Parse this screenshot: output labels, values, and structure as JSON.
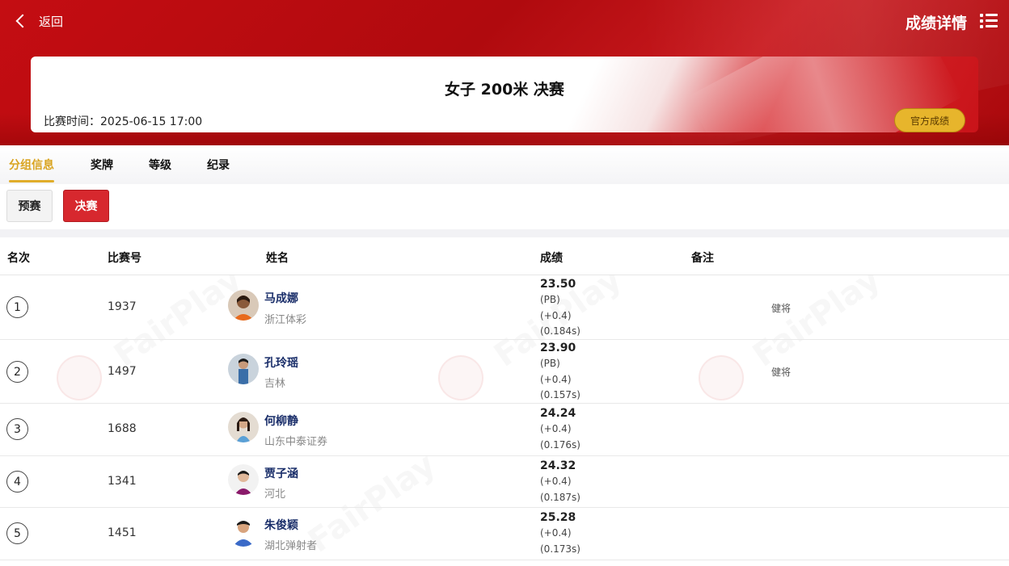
{
  "header": {
    "back_label": "返回",
    "title": "成绩详情",
    "back_icon": "chevron-left-icon",
    "menu_icon": "list-menu-icon"
  },
  "event": {
    "title": "女子 200米 决赛",
    "time": "比赛时间：2025-06-15  17:00",
    "official_button": "官方成绩"
  },
  "tabs": [
    {
      "label": "分组信息",
      "active": true
    },
    {
      "label": "奖牌",
      "active": false
    },
    {
      "label": "等级",
      "active": false
    },
    {
      "label": "纪录",
      "active": false
    }
  ],
  "rounds": [
    {
      "label": "预赛",
      "active": false
    },
    {
      "label": "决赛",
      "active": true
    }
  ],
  "table": {
    "columns": [
      "名次",
      "比赛号",
      "姓名",
      "成绩",
      "备注"
    ],
    "rows": [
      {
        "rank": "1",
        "bib": "1937",
        "name": "马成娜",
        "team": "浙江体彩",
        "result": "23.50",
        "details": [
          "(PB)",
          "(+0.4)",
          "(0.184s)"
        ],
        "note": "健将"
      },
      {
        "rank": "2",
        "bib": "1497",
        "name": "孔玲瑶",
        "team": "吉林",
        "result": "23.90",
        "details": [
          "(PB)",
          "(+0.4)",
          "(0.157s)"
        ],
        "note": "健将"
      },
      {
        "rank": "3",
        "bib": "1688",
        "name": "何柳静",
        "team": "山东中泰证券",
        "result": "24.24",
        "details": [
          "(+0.4)",
          "(0.176s)"
        ],
        "note": ""
      },
      {
        "rank": "4",
        "bib": "1341",
        "name": "贾子涵",
        "team": "河北",
        "result": "24.32",
        "details": [
          "(+0.4)",
          "(0.187s)"
        ],
        "note": ""
      },
      {
        "rank": "5",
        "bib": "1451",
        "name": "朱俊颖",
        "team": "湖北弹射者",
        "result": "25.28",
        "details": [
          "(+0.4)",
          "(0.173s)"
        ],
        "note": ""
      }
    ]
  },
  "colors": {
    "header_red": "#c40d12",
    "gold_accent": "#e0ad2a",
    "final_button": "#d7282e",
    "athlete_name": "#1a2e6a"
  }
}
